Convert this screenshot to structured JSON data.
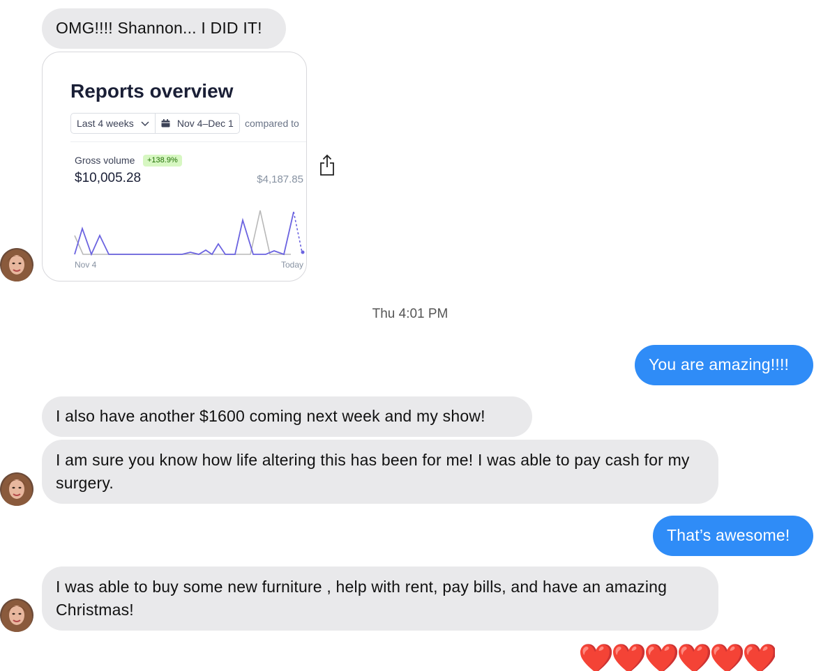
{
  "messages": {
    "m1": "OMG!!!! Shannon... I DID IT!",
    "timestamp": "Thu 4:01 PM",
    "m2": "You are amazing!!!!",
    "m3": "I also have another $1600 coming next week and my show!",
    "m4": "I am sure you know how life altering this has been for me! I was able to pay cash for my surgery.",
    "m5": "That’s awesome!",
    "m6": "I was able to buy some new furniture , help with rent, pay bills, and have an amazing Christmas!",
    "reaction": "❤️❤️❤️❤️❤️❤️"
  },
  "attachment": {
    "title": "Reports overview",
    "range_label": "Last 4 weeks",
    "date_label": "Nov 4–Dec 1",
    "compare_label": "compared to",
    "metric_label": "Gross volume",
    "change_badge": "+138.9%",
    "metric_value": "$10,005.28",
    "compare_value": "$4,187.85",
    "axis_start": "Nov 4",
    "axis_end": "Today"
  },
  "colors": {
    "sent_bubble": "#2f8cf7",
    "received_bubble": "#e9e9eb",
    "chart_current": "#6b63e0",
    "chart_previous": "#b8b8b8"
  },
  "icons": {
    "share": "share-icon",
    "avatar": "avatar"
  }
}
